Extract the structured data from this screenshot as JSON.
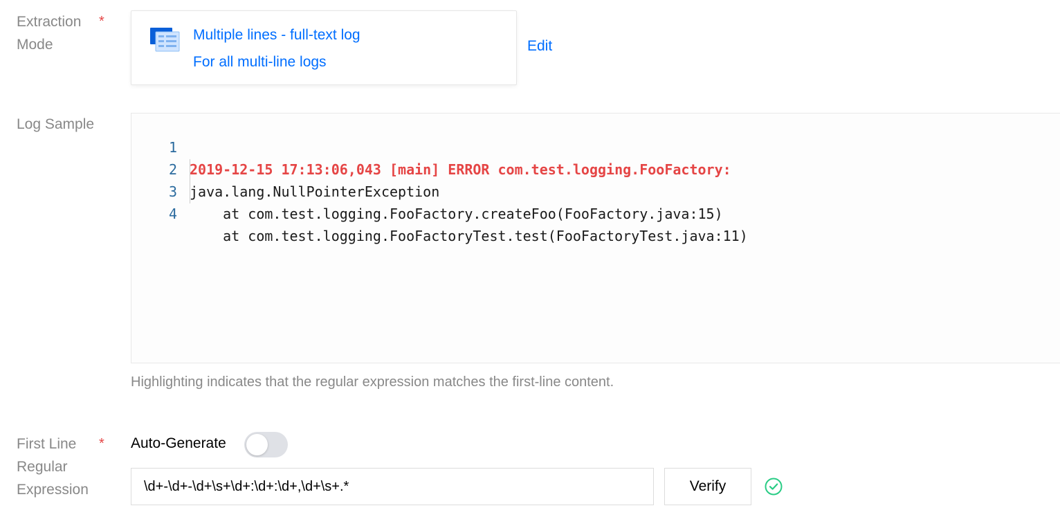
{
  "extraction_mode": {
    "label": "Extraction Mode",
    "required_mark": "*",
    "icon": "multi-line-log-icon",
    "title": "Multiple lines - full-text log",
    "description": "For all multi-line logs",
    "edit_label": "Edit"
  },
  "log_sample": {
    "label": "Log Sample",
    "lines": [
      {
        "number": "1",
        "text": "2019-12-15 17:13:06,043 [main] ERROR com.test.logging.FooFactory:",
        "highlighted": true
      },
      {
        "number": "2",
        "text": "java.lang.NullPointerException",
        "highlighted": false
      },
      {
        "number": "3",
        "text": "    at com.test.logging.FooFactory.createFoo(FooFactory.java:15)",
        "highlighted": false
      },
      {
        "number": "4",
        "text": "    at com.test.logging.FooFactoryTest.test(FooFactoryTest.java:11)",
        "highlighted": false
      }
    ],
    "hint": "Highlighting indicates that the regular expression matches the first-line content."
  },
  "first_line_regex": {
    "label_line1": "First Line",
    "label_line2": "Regular",
    "label_line3": "Expression",
    "required_mark": "*",
    "auto_generate_label": "Auto-Generate",
    "auto_generate_enabled": false,
    "value": "\\d+-\\d+-\\d+\\s+\\d+:\\d+:\\d+,\\d+\\s+.*",
    "verify_label": "Verify",
    "status_icon": "check-circle-icon"
  },
  "colors": {
    "accent": "#006eff",
    "required": "#e54545",
    "error_text": "#e54545",
    "success": "#29cc85"
  }
}
